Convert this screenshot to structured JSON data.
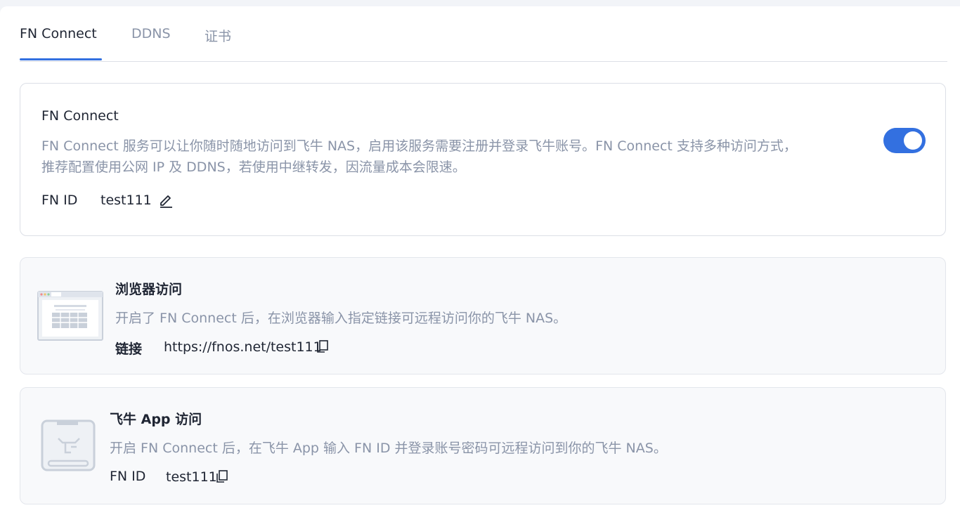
{
  "tabs": [
    {
      "label": "FN Connect",
      "active": true
    },
    {
      "label": "DDNS",
      "active": false
    },
    {
      "label": "证书",
      "active": false
    }
  ],
  "connect_card": {
    "title": "FN Connect",
    "description_line1": "FN Connect 服务可以让你随时随地访问到飞牛 NAS，启用该服务需要注册并登录飞牛账号。FN Connect 支持多种访问方式，",
    "description_line2": "推荐配置使用公网 IP 及 DDNS，若使用中继转发，因流量成本会限速。",
    "fn_id_label": "FN ID",
    "fn_id_value": "test111",
    "enabled": true,
    "edit_icon": "edit-icon"
  },
  "browser_card": {
    "title": "浏览器访问",
    "description": "开启了 FN Connect 后，在浏览器输入指定链接可远程访问你的飞牛 NAS。",
    "link_label": "链接",
    "link_value": "https://fnos.net/test111",
    "copy_icon": "copy-icon",
    "illustration": "browser-illustration"
  },
  "app_card": {
    "title": "飞牛 App 访问",
    "description": "开启 FN Connect 后，在飞牛 App 输入 FN ID 并登录账号密码可远程访问到你的飞牛 NAS。",
    "fn_id_label": "FN ID",
    "fn_id_value": "test111",
    "copy_icon": "copy-icon",
    "illustration": "app-illustration"
  },
  "colors": {
    "accent": "#3370e0",
    "muted_text": "#8a94a8",
    "card_gray": "#f8f9fb",
    "border": "#dcdfe6"
  }
}
